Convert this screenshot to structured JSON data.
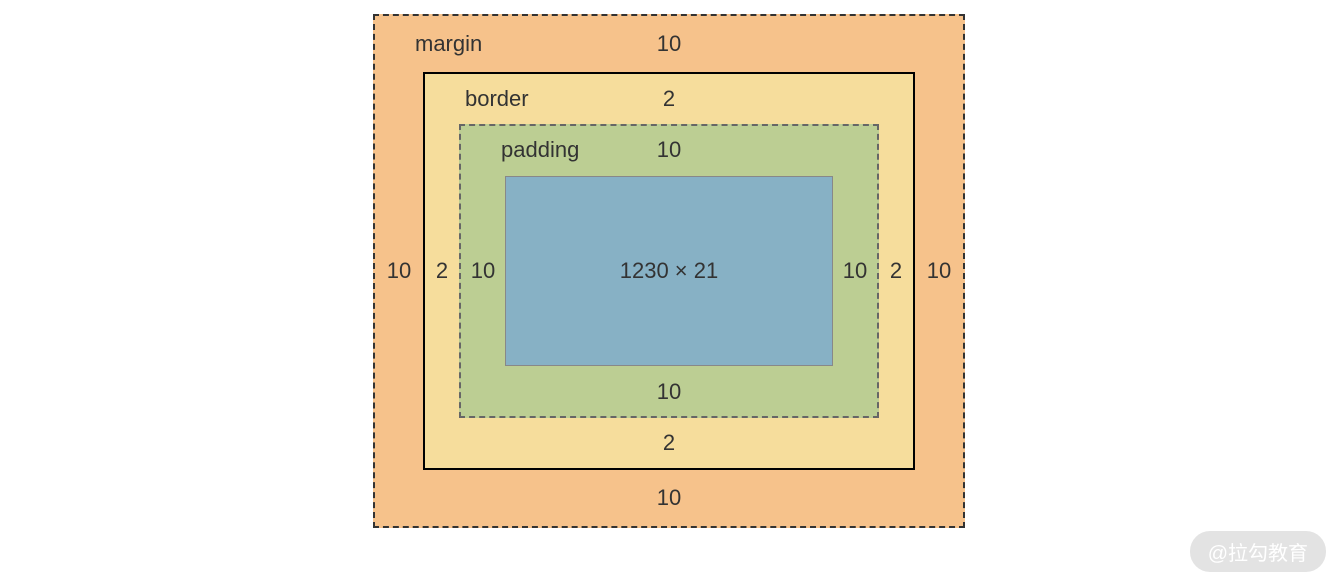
{
  "box_model": {
    "margin": {
      "label": "margin",
      "top": "10",
      "right": "10",
      "bottom": "10",
      "left": "10"
    },
    "border": {
      "label": "border",
      "top": "2",
      "right": "2",
      "bottom": "2",
      "left": "2"
    },
    "padding": {
      "label": "padding",
      "top": "10",
      "right": "10",
      "bottom": "10",
      "left": "10"
    },
    "content": {
      "text": "1230 × 21"
    }
  },
  "watermark": "@拉勾教育",
  "colors": {
    "margin": "#f6c28b",
    "border": "#f6dd9c",
    "padding": "#bcce93",
    "content": "#87b1c5"
  }
}
